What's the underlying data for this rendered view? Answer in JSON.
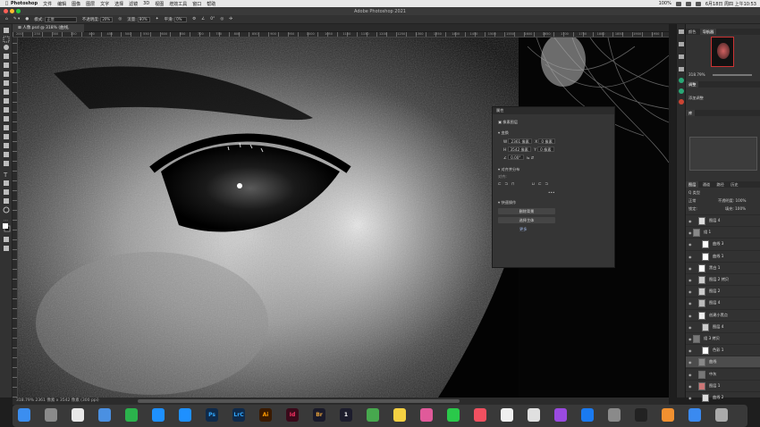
{
  "menubar": {
    "app": "Photoshop",
    "items": [
      "文件",
      "编辑",
      "图像",
      "图层",
      "文字",
      "选择",
      "滤镜",
      "3D",
      "视图",
      "增效工具",
      "窗口",
      "帮助"
    ],
    "battery": "100%",
    "datetime": "6月18日 周四 上午10:53"
  },
  "titlebar": {
    "title": "Adobe Photoshop 2021"
  },
  "optionsbar": {
    "mode_label": "模式:",
    "mode_value": "正常",
    "opacity_label": "不透明度:",
    "opacity_value": "20%",
    "flow_label": "流量:",
    "flow_value": "80%",
    "smooth_label": "平滑:",
    "smooth_value": "0%",
    "angle_value": "0°"
  },
  "document": {
    "tab": "⊠ 人像.psd @ 318% (曲线, RGB/16) *",
    "status": "318.79%   2361 像素 x 3542 像素 (300 ppi)",
    "ruler_marks": [
      "200",
      "250",
      "300",
      "350",
      "400",
      "450",
      "500",
      "550",
      "600",
      "650",
      "700",
      "750",
      "800",
      "850",
      "900",
      "950",
      "1000",
      "1050",
      "1100",
      "1150",
      "1200",
      "1250",
      "1300",
      "1350",
      "1400",
      "1450",
      "1500",
      "1550",
      "1600",
      "1650",
      "1700",
      "1750",
      "1800",
      "1850",
      "1900",
      "1950"
    ]
  },
  "properties": {
    "title": "属性",
    "doc_label": "像素图层",
    "section_transform": "变换",
    "w_label": "W",
    "w_value": "2361 像素",
    "x_label": "X",
    "x_value": "0 像素",
    "h_label": "H",
    "h_value": "3542 像素",
    "y_label": "Y",
    "y_value": "0 像素",
    "angle_value": "0.00°",
    "section_align": "对齐并分布",
    "align_sub": "对齐:",
    "section_quick": "快速操作",
    "btn_remove_bg": "删除背景",
    "btn_select_subject": "选择主体",
    "btn_more": "更多"
  },
  "rightpanel": {
    "tabs_top": [
      "颜色",
      "导航器"
    ],
    "zoom_value": "318.79%",
    "adjust_tab": "调整",
    "add_adjust": "添加调整",
    "libraries_tab": "库",
    "layers_tabs": [
      "图层",
      "通道",
      "路径",
      "历史"
    ],
    "kind_label": "Q 类型",
    "blend_mode": "正常",
    "opacity_label": "不透明度:",
    "opacity_value": "100%",
    "fill_label": "填充:",
    "fill_value": "100%",
    "lock_label": "锁定:",
    "layers": [
      {
        "name": "图层 4",
        "selected": false
      },
      {
        "name": "组 1",
        "selected": false
      },
      {
        "name": "曲线 3",
        "selected": false
      },
      {
        "name": "曲线 1",
        "selected": false
      },
      {
        "name": "黑白 1",
        "selected": false
      },
      {
        "name": "图层 2 拷贝",
        "selected": false
      },
      {
        "name": "图层 2",
        "selected": false
      },
      {
        "name": "图层 4",
        "selected": false
      },
      {
        "name": "创建小黑点",
        "selected": false
      },
      {
        "name": "图层 4",
        "selected": false
      },
      {
        "name": "组 3 拷贝",
        "selected": false
      },
      {
        "name": "色彩 1",
        "selected": false
      },
      {
        "name": "曲线",
        "selected": true
      },
      {
        "name": "中灰",
        "selected": false
      },
      {
        "name": "图层 1",
        "selected": false
      },
      {
        "name": "曲线 2",
        "selected": false
      }
    ]
  },
  "dock": {
    "apps": [
      "Finder",
      "Launchpad",
      "Chrome",
      "Mail",
      "WeChat",
      "QQ",
      "Safari",
      "Ps",
      "LrC",
      "Ai",
      "Id",
      "Br",
      "1",
      "Maps",
      "Notes",
      "Photos",
      "Messages",
      "Music",
      "Calendar",
      "Reminders",
      "Podcasts",
      "App Store",
      "Settings",
      "TV",
      "Books",
      "Downloads",
      "Trash"
    ]
  }
}
